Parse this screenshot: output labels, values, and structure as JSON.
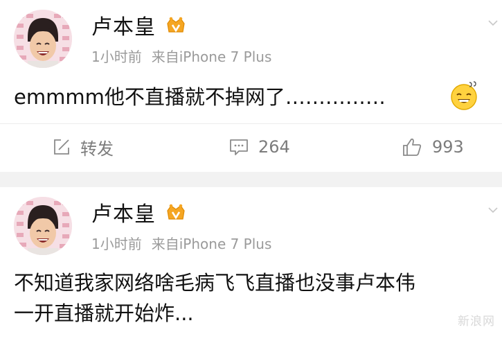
{
  "posts": [
    {
      "username": "卢本皇",
      "time": "1小时前",
      "source": "来自iPhone 7 Plus",
      "content": "emmmm他不直播就不掉网了……………",
      "emoji_icon": "sweat-smile-emoji-icon",
      "actions": {
        "repost": "转发",
        "comments": "264",
        "likes": "993"
      }
    },
    {
      "username": "卢本皇",
      "time": "1小时前",
      "source": "来自iPhone 7 Plus",
      "content_lines": [
        "不知道我家网络啥毛病飞飞直播也没事卢本伟",
        "一开直播就开始炸..."
      ]
    }
  ],
  "watermark": "新浪网",
  "colors": {
    "meta_gray": "#9a9a9a",
    "divider": "#ececec",
    "gap": "#f2f2f2",
    "vip_gold": "#f5a623"
  }
}
